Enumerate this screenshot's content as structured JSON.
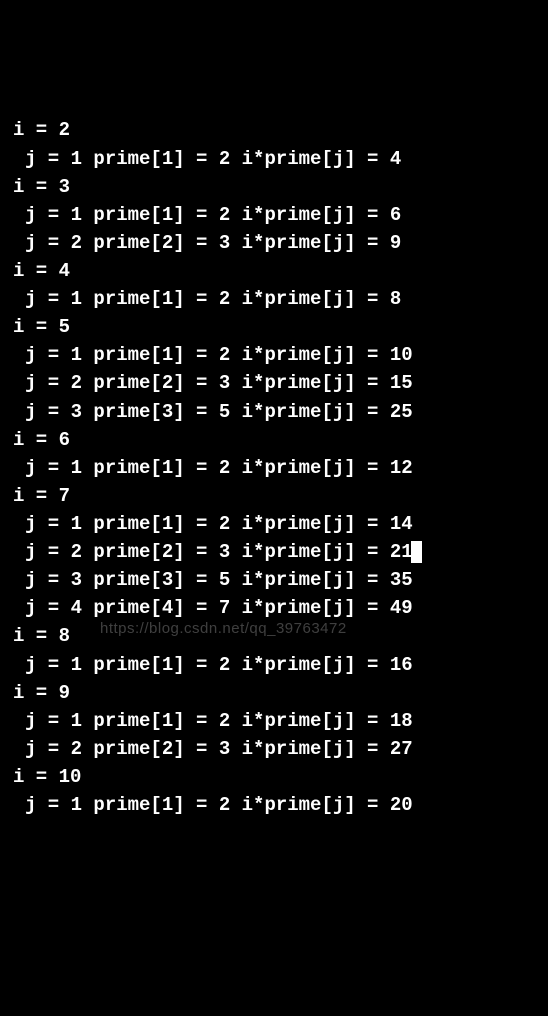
{
  "terminal": {
    "lines": [
      {
        "indent": "outer",
        "text": "i = 2"
      },
      {
        "indent": "inner",
        "text": "j = 1 prime[1] = 2 i*prime[j] = 4"
      },
      {
        "indent": "outer",
        "text": "i = 3"
      },
      {
        "indent": "inner",
        "text": "j = 1 prime[1] = 2 i*prime[j] = 6"
      },
      {
        "indent": "inner",
        "text": "j = 2 prime[2] = 3 i*prime[j] = 9"
      },
      {
        "indent": "outer",
        "text": "i = 4"
      },
      {
        "indent": "inner",
        "text": "j = 1 prime[1] = 2 i*prime[j] = 8"
      },
      {
        "indent": "outer",
        "text": "i = 5"
      },
      {
        "indent": "inner",
        "text": "j = 1 prime[1] = 2 i*prime[j] = 10"
      },
      {
        "indent": "inner",
        "text": "j = 2 prime[2] = 3 i*prime[j] = 15"
      },
      {
        "indent": "inner",
        "text": "j = 3 prime[3] = 5 i*prime[j] = 25"
      },
      {
        "indent": "outer",
        "text": "i = 6"
      },
      {
        "indent": "inner",
        "text": "j = 1 prime[1] = 2 i*prime[j] = 12"
      },
      {
        "indent": "outer",
        "text": "i = 7"
      },
      {
        "indent": "inner",
        "text": "j = 1 prime[1] = 2 i*prime[j] = 14"
      },
      {
        "indent": "inner",
        "text": "j = 2 prime[2] = 3 i*prime[j] = 21",
        "cursor": true
      },
      {
        "indent": "inner",
        "text": "j = 3 prime[3] = 5 i*prime[j] = 35"
      },
      {
        "indent": "inner",
        "text": "j = 4 prime[4] = 7 i*prime[j] = 49"
      },
      {
        "indent": "outer",
        "text": "i = 8"
      },
      {
        "indent": "inner",
        "text": "j = 1 prime[1] = 2 i*prime[j] = 16"
      },
      {
        "indent": "outer",
        "text": "i = 9"
      },
      {
        "indent": "inner",
        "text": "j = 1 prime[1] = 2 i*prime[j] = 18"
      },
      {
        "indent": "inner",
        "text": "j = 2 prime[2] = 3 i*prime[j] = 27"
      },
      {
        "indent": "outer",
        "text": "i = 10"
      },
      {
        "indent": "inner",
        "text": "j = 1 prime[1] = 2 i*prime[j] = 20"
      }
    ]
  },
  "watermark": "https://blog.csdn.net/qq_39763472"
}
